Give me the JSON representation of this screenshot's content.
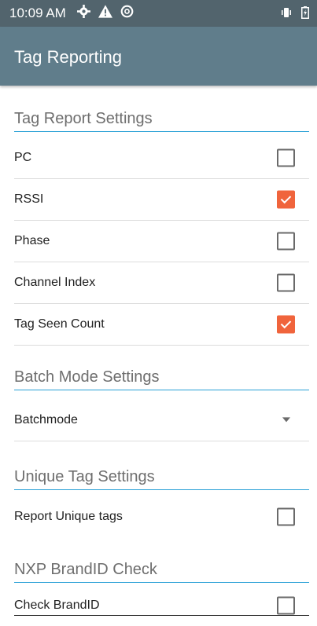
{
  "status_bar": {
    "time": "10:09 AM",
    "icons": [
      "settings-icon",
      "warning-icon",
      "sync-icon"
    ],
    "right_icons": [
      "vibrate-icon",
      "battery-icon"
    ]
  },
  "app_bar": {
    "title": "Tag Reporting",
    "color": "#607d8b"
  },
  "accent": {
    "checkbox_checked": "#f0643c",
    "section_underline": "#29a0d6"
  },
  "sections": {
    "tag_report": {
      "title": "Tag Report Settings",
      "items": [
        {
          "label": "PC",
          "checked": false
        },
        {
          "label": "RSSI",
          "checked": true
        },
        {
          "label": "Phase",
          "checked": false
        },
        {
          "label": "Channel Index",
          "checked": false
        },
        {
          "label": "Tag Seen Count",
          "checked": true
        }
      ]
    },
    "batch_mode": {
      "title": "Batch Mode Settings",
      "dropdown_label": "Batchmode"
    },
    "unique_tag": {
      "title": "Unique Tag Settings",
      "items": [
        {
          "label": "Report Unique tags",
          "checked": false
        }
      ]
    },
    "brandid": {
      "title": "NXP BrandID Check",
      "items": [
        {
          "label": "Check BrandID",
          "checked": false
        }
      ]
    }
  }
}
